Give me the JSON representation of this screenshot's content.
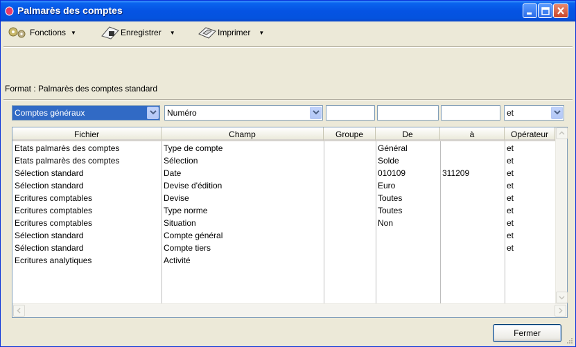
{
  "window": {
    "title": "Palmarès des comptes"
  },
  "toolbar": {
    "fonctions": "Fonctions",
    "enregistrer": "Enregistrer",
    "imprimer": "Imprimer"
  },
  "format_text": "Format : Palmarès des comptes standard",
  "filter": {
    "fichier_value": "Comptes généraux",
    "champ_value": "Numéro",
    "groupe_value": "",
    "de_value": "",
    "a_value": "",
    "operateur_value": "et"
  },
  "grid": {
    "headers": [
      "Fichier",
      "Champ",
      "Groupe",
      "De",
      "à",
      "Opérateur"
    ],
    "rows": [
      {
        "fichier": "Etats palmarès des comptes",
        "champ": "Type de compte",
        "groupe": "",
        "de": "Général",
        "a": "",
        "op": "et"
      },
      {
        "fichier": "Etats palmarès des comptes",
        "champ": "Sélection",
        "groupe": "",
        "de": "Solde",
        "a": "",
        "op": "et"
      },
      {
        "fichier": "Sélection standard",
        "champ": "Date",
        "groupe": "",
        "de": "010109",
        "a": "311209",
        "op": "et"
      },
      {
        "fichier": "Sélection standard",
        "champ": "Devise d'édition",
        "groupe": "",
        "de": "Euro",
        "a": "",
        "op": "et"
      },
      {
        "fichier": "Ecritures comptables",
        "champ": "Devise",
        "groupe": "",
        "de": "Toutes",
        "a": "",
        "op": "et"
      },
      {
        "fichier": "Ecritures comptables",
        "champ": "Type norme",
        "groupe": "",
        "de": "Toutes",
        "a": "",
        "op": "et"
      },
      {
        "fichier": "Ecritures comptables",
        "champ": "Situation",
        "groupe": "",
        "de": "Non",
        "a": "",
        "op": "et"
      },
      {
        "fichier": "Sélection standard",
        "champ": "Compte général",
        "groupe": "",
        "de": "",
        "a": "",
        "op": "et"
      },
      {
        "fichier": "Sélection standard",
        "champ": "Compte tiers",
        "groupe": "",
        "de": "",
        "a": "",
        "op": "et"
      },
      {
        "fichier": "Ecritures analytiques",
        "champ": "Activité",
        "groupe": "",
        "de": "",
        "a": "",
        "op": ""
      }
    ]
  },
  "buttons": {
    "fermer": "Fermer"
  },
  "colors": {
    "titlebar": "#0553E3",
    "selection": "#316AC5",
    "face": "#ECE9D8"
  }
}
